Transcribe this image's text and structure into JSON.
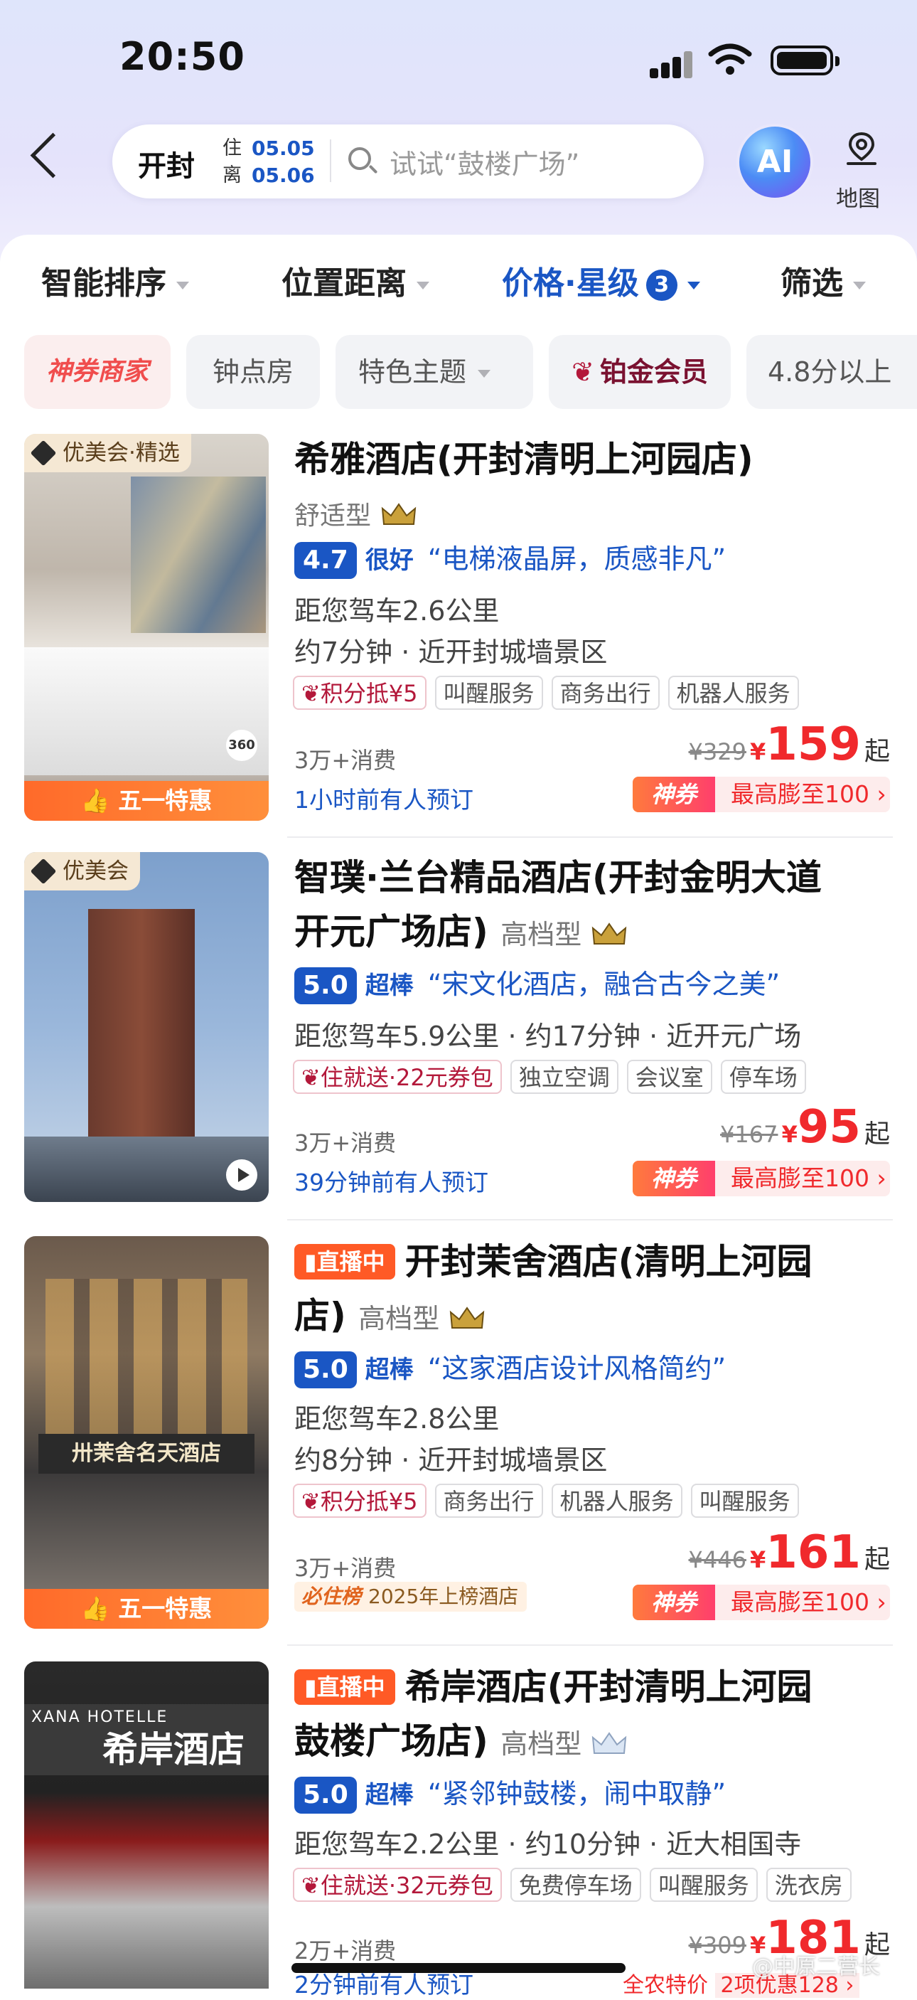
{
  "status_bar": {
    "time": "20:50"
  },
  "header": {
    "city": "开封",
    "checkin_label": "住",
    "checkin_date": "05.05",
    "checkout_label": "离",
    "checkout_date": "05.06",
    "search_placeholder": "试试“鼓楼广场”",
    "ai_label": "AI",
    "map_label": "地图"
  },
  "sort_bar": {
    "items": [
      "智能排序",
      "位置距离",
      "价格·星级",
      "筛选"
    ],
    "active_index": 2,
    "active_count": "3"
  },
  "filter_chips": [
    "神券商家",
    "钟点房",
    "特色主题",
    "铂金会员",
    "4.8分以上"
  ],
  "hotels": [
    {
      "image_tag": "优美会·精选",
      "image_banner": "五一特惠",
      "name": "希雅酒店(开封清明上河园店)",
      "grade": "舒适型",
      "score": "4.7",
      "score_word": "很好",
      "quote": "“电梯液晶屏，质感非凡”",
      "info_lines": [
        "距您驾车2.6公里",
        "约7分钟 · 近开封城墙景区"
      ],
      "tags": [
        "积分抵¥5",
        "叫醒服务",
        "商务出行",
        "机器人服务"
      ],
      "spend": "3万+消费",
      "booked": "1小时前有人预订",
      "orig_price": "¥329",
      "currency": "¥",
      "price": "159",
      "price_suffix": "起",
      "coupon_tag": "神券",
      "coupon_text": "最高膨至100 ›"
    },
    {
      "image_tag": "优美会",
      "name_line1": "智璞·兰台精品酒店(开封金明大道",
      "name_line2": "开元广场店)",
      "grade": "高档型",
      "score": "5.0",
      "score_word": "超棒",
      "quote": "“宋文化酒店，融合古今之美”",
      "info_lines": [
        "距您驾车5.9公里 · 约17分钟 · 近开元广场"
      ],
      "tags": [
        "住就送·22元券包",
        "独立空调",
        "会议室",
        "停车场"
      ],
      "spend": "3万+消费",
      "booked": "39分钟前有人预订",
      "orig_price": "¥167",
      "currency": "¥",
      "price": "95",
      "price_suffix": "起",
      "coupon_tag": "神券",
      "coupon_text": "最高膨至100 ›"
    },
    {
      "live": "直播中",
      "image_banner": "五一特惠",
      "name_line1": "开封茉舍酒店(清明上河园",
      "name_line2": "店)",
      "grade": "高档型",
      "score": "5.0",
      "score_word": "超棒",
      "quote": "“这家酒店设计风格简约”",
      "info_lines": [
        "距您驾车2.8公里",
        "约8分钟 · 近开封城墙景区"
      ],
      "tags": [
        "积分抵¥5",
        "商务出行",
        "机器人服务",
        "叫醒服务"
      ],
      "spend": "3万+消费",
      "list_badge_brand": "必住榜",
      "list_badge_text": "2025年上榜酒店",
      "orig_price": "¥446",
      "currency": "¥",
      "price": "161",
      "price_suffix": "起",
      "coupon_tag": "神券",
      "coupon_text": "最高膨至100 ›"
    },
    {
      "live": "直播中",
      "sign_text": "希岸酒店",
      "sign_sub": "XANA HOTELLE",
      "name_line1": "希岸酒店(开封清明上河园",
      "name_line2": "鼓楼广场店)",
      "grade": "高档型",
      "score": "5.0",
      "score_word": "超棒",
      "quote": "“紧邻钟鼓楼，闹中取静”",
      "info_lines": [
        "距您驾车2.2公里 · 约10分钟 · 近大相国寺"
      ],
      "tags": [
        "住就送·32元券包",
        "免费停车场",
        "叫醒服务",
        "洗衣房"
      ],
      "spend": "2万+消费",
      "booked": "2分钟前有人预订",
      "orig_price": "¥309",
      "currency": "¥",
      "price": "181",
      "price_suffix": "起",
      "promo_a": "全农特价",
      "promo_b": "2项优惠128 ›"
    }
  ],
  "watermark": "@中原二营长"
}
